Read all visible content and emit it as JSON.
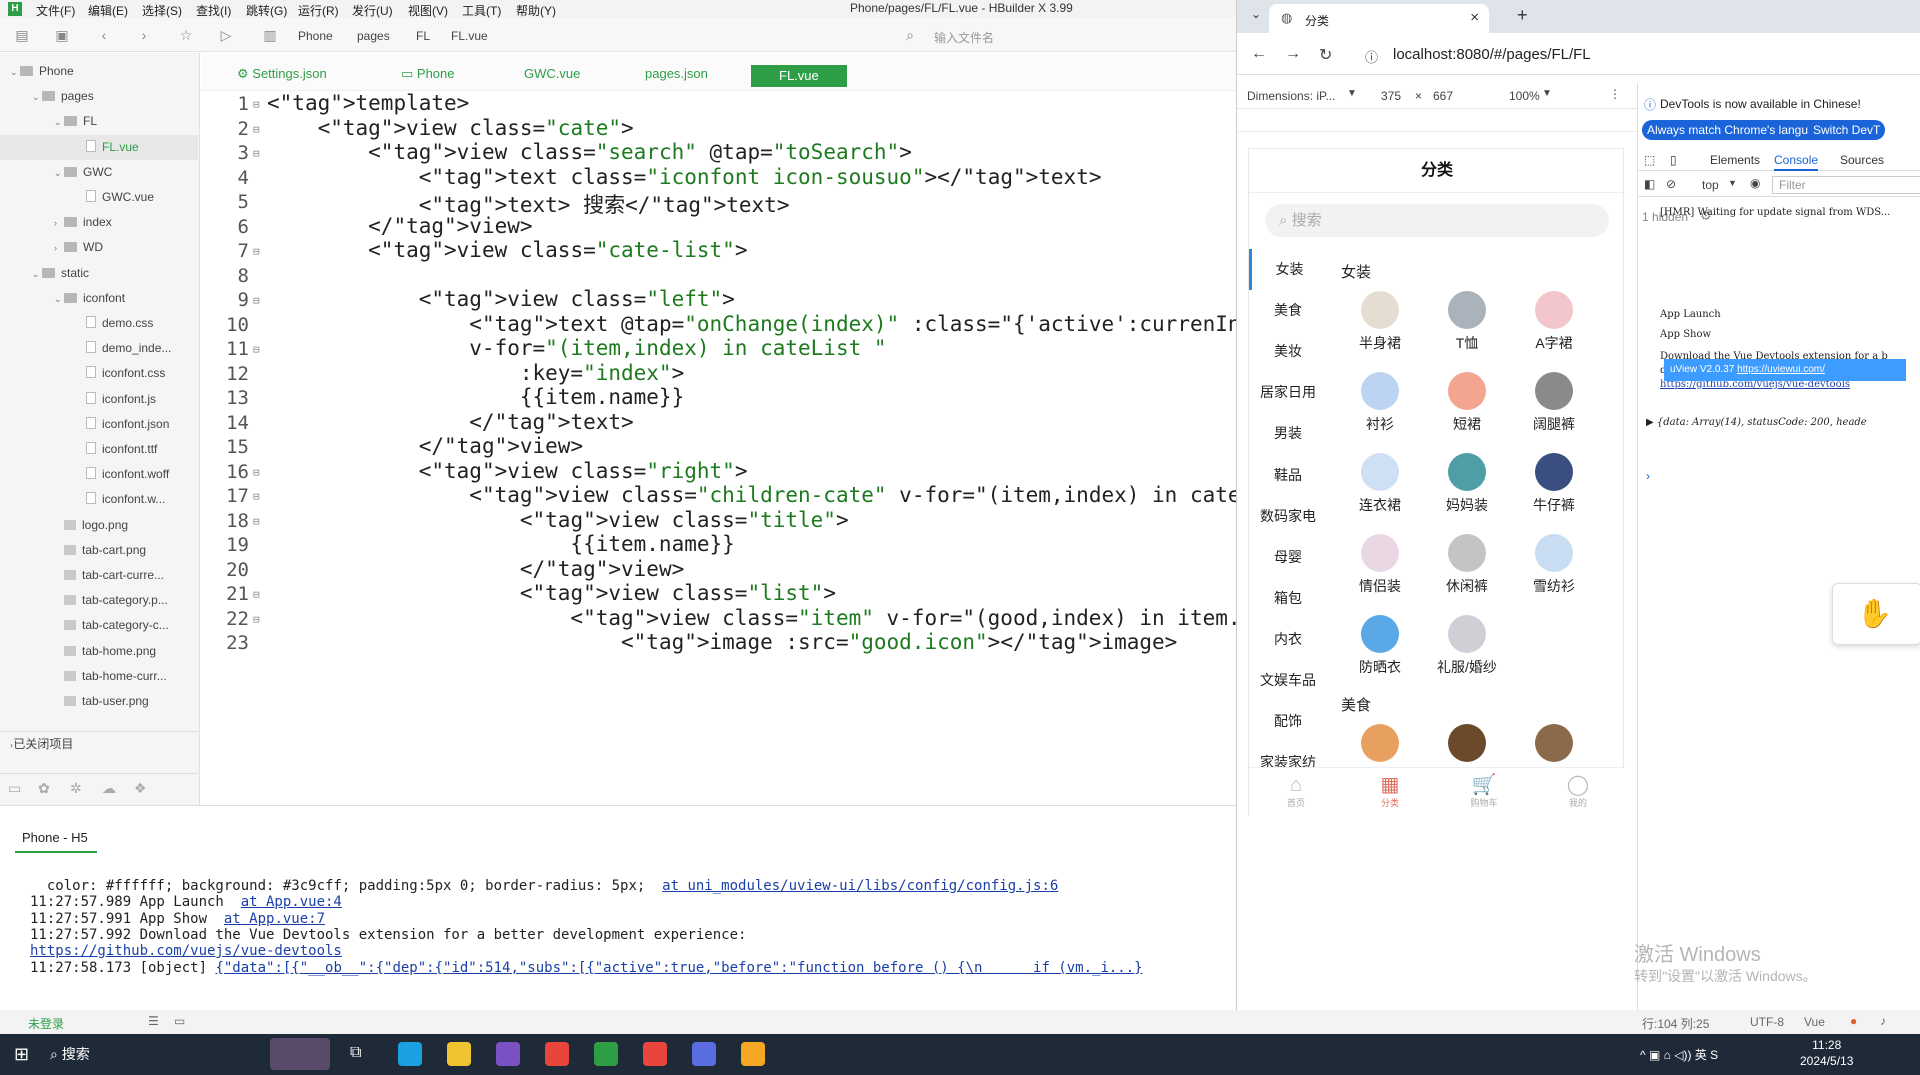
{
  "ide": {
    "menus": [
      "文件(F)",
      "编辑(E)",
      "选择(S)",
      "查找(I)",
      "跳转(G)",
      "运行(R)",
      "发行(U)",
      "视图(V)",
      "工具(T)",
      "帮助(Y)"
    ],
    "window_title": "Phone/pages/FL/FL.vue - HBuilder X 3.99",
    "breadcrumb": [
      "Phone",
      "pages",
      "FL",
      "FL.vue"
    ],
    "search_placeholder": "输入文件名",
    "tree": [
      {
        "label": "Phone",
        "type": "folder",
        "depth": 0,
        "open": true
      },
      {
        "label": "pages",
        "type": "folder",
        "depth": 1,
        "open": true
      },
      {
        "label": "FL",
        "type": "folder",
        "depth": 2,
        "open": true
      },
      {
        "label": "FL.vue",
        "type": "file",
        "depth": 3,
        "selected": true
      },
      {
        "label": "GWC",
        "type": "folder",
        "depth": 2,
        "open": true
      },
      {
        "label": "GWC.vue",
        "type": "file",
        "depth": 3
      },
      {
        "label": "index",
        "type": "folder",
        "depth": 2,
        "open": false
      },
      {
        "label": "WD",
        "type": "folder",
        "depth": 2,
        "open": false
      },
      {
        "label": "static",
        "type": "folder",
        "depth": 1,
        "open": true
      },
      {
        "label": "iconfont",
        "type": "folder",
        "depth": 2,
        "open": true
      },
      {
        "label": "demo.css",
        "type": "file",
        "depth": 3
      },
      {
        "label": "demo_inde...",
        "type": "file",
        "depth": 3
      },
      {
        "label": "iconfont.css",
        "type": "file",
        "depth": 3
      },
      {
        "label": "iconfont.js",
        "type": "file",
        "depth": 3
      },
      {
        "label": "iconfont.json",
        "type": "file",
        "depth": 3
      },
      {
        "label": "iconfont.ttf",
        "type": "file",
        "depth": 3
      },
      {
        "label": "iconfont.woff",
        "type": "file",
        "depth": 3
      },
      {
        "label": "iconfont.w...",
        "type": "file",
        "depth": 3
      },
      {
        "label": "logo.png",
        "type": "img",
        "depth": 2
      },
      {
        "label": "tab-cart.png",
        "type": "img",
        "depth": 2
      },
      {
        "label": "tab-cart-curre...",
        "type": "img",
        "depth": 2
      },
      {
        "label": "tab-category.p...",
        "type": "img",
        "depth": 2
      },
      {
        "label": "tab-category-c...",
        "type": "img",
        "depth": 2
      },
      {
        "label": "tab-home.png",
        "type": "img",
        "depth": 2
      },
      {
        "label": "tab-home-curr...",
        "type": "img",
        "depth": 2
      },
      {
        "label": "tab-user.png",
        "type": "img",
        "depth": 2
      }
    ],
    "closed_projects": "已关闭项目",
    "tabs": [
      "Settings.json",
      "Phone",
      "GWC.vue",
      "pages.json",
      "FL.vue"
    ],
    "active_tab": "FL.vue",
    "code_lines": [
      {
        "n": "1",
        "text": "<template>"
      },
      {
        "n": "2",
        "text": "    <view class=\"cate\">"
      },
      {
        "n": "3",
        "text": "        <view class=\"search\" @tap=\"toSearch\">"
      },
      {
        "n": "4",
        "text": "            <text class=\"iconfont icon-sousuo\"></text>"
      },
      {
        "n": "5",
        "text": "            <text> 搜索</text>"
      },
      {
        "n": "6",
        "text": "        </view>"
      },
      {
        "n": "7",
        "text": "        <view class=\"cate-list\">"
      },
      {
        "n": "8",
        "text": ""
      },
      {
        "n": "9",
        "text": "            <view class=\"left\">"
      },
      {
        "n": "10",
        "text": "                <text @tap=\"onChange(index)\" :class=\"{'active':currenIndex=="
      },
      {
        "n": "11",
        "text": "                v-for=\"(item,index) in cateList \""
      },
      {
        "n": "12",
        "text": "                    :key=\"index\">"
      },
      {
        "n": "13",
        "text": "                    {{item.name}}"
      },
      {
        "n": "14",
        "text": "                </text>"
      },
      {
        "n": "15",
        "text": "            </view>"
      },
      {
        "n": "16",
        "text": "            <view class=\"right\">"
      },
      {
        "n": "17",
        "text": "                <view class=\"children-cate\" v-for=\"(item,index) in cateList"
      },
      {
        "n": "18",
        "text": "                    <view class=\"title\">"
      },
      {
        "n": "19",
        "text": "                        {{item.name}}"
      },
      {
        "n": "20",
        "text": "                    </view>"
      },
      {
        "n": "21",
        "text": "                    <view class=\"list\">"
      },
      {
        "n": "22",
        "text": "                        <view class=\"item\" v-for=\"(good,index) in item.chi"
      },
      {
        "n": "23",
        "text": "                            <image :src=\"good.icon\"></image>"
      }
    ],
    "console_title": "Phone - H5",
    "console_lines": [
      {
        "text": "  color: #ffffff; background: #3c9cff; padding:5px 0; border-radius: 5px;  ",
        "link": "at uni_modules/uview-ui/libs/config/config.js:6"
      },
      {
        "text": "11:27:57.989 App Launch  ",
        "link": "at App.vue:4"
      },
      {
        "text": "11:27:57.991 App Show  ",
        "link": "at App.vue:7"
      },
      {
        "text": "11:27:57.992 Download the Vue Devtools extension for a better development experience:",
        "link": ""
      },
      {
        "text": "",
        "link": "https://github.com/vuejs/vue-devtools"
      },
      {
        "text": "11:27:58.173 [object] ",
        "link": "{\"data\":[{\"__ob__\":{\"dep\":{\"id\":514,\"subs\":[{\"active\":true,\"before\":\"function before () {\\n      if (vm._i...}"
      }
    ],
    "status_login": "未登录",
    "status_right": {
      "pos": "行:104  列:25",
      "enc": "UTF-8",
      "lang": "Vue"
    }
  },
  "browser": {
    "tab_title": "分类",
    "url": "localhost:8080/#/pages/FL/FL",
    "dimensions_label": "Dimensions: iP...",
    "width": "375",
    "height": "667",
    "zoom": "100%",
    "phone": {
      "title": "分类",
      "search_placeholder": "搜索",
      "left_categories": [
        "女装",
        "美食",
        "美妆",
        "居家日用",
        "男装",
        "鞋品",
        "数码家电",
        "母婴",
        "箱包",
        "内衣",
        "文娱车品",
        "配饰",
        "家装家纺"
      ],
      "active_category": "女装",
      "sections": [
        {
          "title": "女装",
          "items": [
            {
              "name": "半身裙",
              "color": "#e6ddd2"
            },
            {
              "name": "T恤",
              "color": "#aab3bb"
            },
            {
              "name": "A字裙",
              "color": "#f3c6cc"
            },
            {
              "name": "衬衫",
              "color": "#bcd3f2"
            },
            {
              "name": "短裙",
              "color": "#f3a58f"
            },
            {
              "name": "阔腿裤",
              "color": "#8a8a8a"
            },
            {
              "name": "连衣裙",
              "color": "#cfe0f4"
            },
            {
              "name": "妈妈装",
              "color": "#4e9ea8"
            },
            {
              "name": "牛仔裤",
              "color": "#3a4e80"
            },
            {
              "name": "情侣装",
              "color": "#e9d7e3"
            },
            {
              "name": "休闲裤",
              "color": "#c4c4c4"
            },
            {
              "name": "雪纺衫",
              "color": "#c8dcf2"
            },
            {
              "name": "防晒衣",
              "color": "#5aa9e6"
            },
            {
              "name": "礼服/婚纱",
              "color": "#cfcfd6"
            }
          ]
        },
        {
          "title": "美食",
          "items": [
            {
              "name": "",
              "color": "#e8a060"
            },
            {
              "name": "",
              "color": "#6a4a2a"
            },
            {
              "name": "",
              "color": "#8a6a4a"
            }
          ]
        }
      ],
      "tabbar": [
        "首页",
        "分类",
        "购物车",
        "我的"
      ],
      "tabbar_active": "分类"
    },
    "devtools": {
      "notice": "DevTools is now available in Chinese!",
      "btn_match": "Always match Chrome's language",
      "btn_switch": "Switch DevT",
      "tabs": [
        "Elements",
        "Console",
        "Sources"
      ],
      "active_tab": "Console",
      "context": "top",
      "filter_placeholder": "Filter",
      "hidden": "1 hidden",
      "log": [
        "[HMR] Waiting for update signal from WDS...",
        "App Launch",
        "App Show",
        "Download the Vue Devtools extension for a b",
        "development experience:",
        "https://github.com/vuejs/vue-devtools",
        "▶ {data: Array(14), statusCode: 200, heade"
      ],
      "uview_text": "uView V2.0.37 ",
      "uview_link": "https://uviewui.com/"
    },
    "watermark_1": "激活 Windows",
    "watermark_2": "转到\"设置\"以激活 Windows。"
  },
  "taskbar": {
    "search": "搜索",
    "time": "11:28",
    "date": "2024/5/13",
    "icons": [
      {
        "name": "edge",
        "color": "#1ba0e2"
      },
      {
        "name": "explorer",
        "color": "#f1c232"
      },
      {
        "name": "vs",
        "color": "#7b52c6"
      },
      {
        "name": "chrome",
        "color": "#e8453c"
      },
      {
        "name": "hbuilder",
        "color": "#2e9e46"
      },
      {
        "name": "chrome2",
        "color": "#e8453c"
      },
      {
        "name": "app7",
        "color": "#5b6ee1"
      },
      {
        "name": "app8",
        "color": "#f5a623"
      }
    ]
  }
}
